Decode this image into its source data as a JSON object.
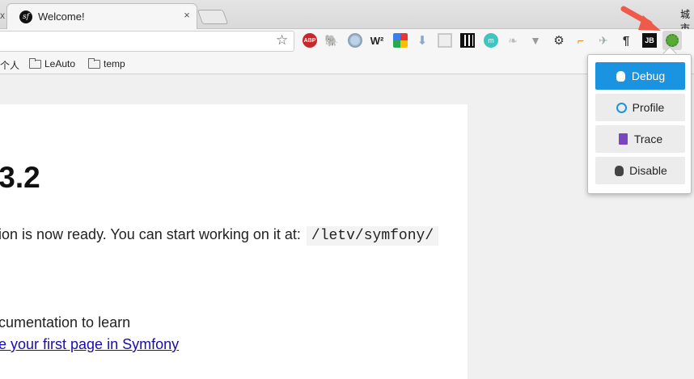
{
  "tab": {
    "title": "Welcome!",
    "close": "×"
  },
  "tab_cut": "x",
  "profile_text": "城市",
  "extensions": {
    "abp": "ABP",
    "w2": "W²",
    "jb": "JB",
    "more": "⋮"
  },
  "bookmarks": {
    "partial": "个人",
    "items": [
      "LeAuto",
      "temp"
    ]
  },
  "page": {
    "version": ".3.2",
    "ready_text": "ion is now ready. You can start working on it at:",
    "path": "/letv/symfony/",
    "learn_text": "cumentation to learn",
    "link_text": "e your first page in Symfony"
  },
  "popup": {
    "buttons": [
      {
        "label": "Debug",
        "icon": "bug-icon",
        "active": true
      },
      {
        "label": "Profile",
        "icon": "clock-icon",
        "active": false
      },
      {
        "label": "Trace",
        "icon": "trace-icon",
        "active": false
      },
      {
        "label": "Disable",
        "icon": "bug-icon",
        "active": false
      }
    ]
  },
  "colors": {
    "primary_button": "#1a94e0",
    "arrow": "#f05a4a",
    "link": "#1a0dab"
  }
}
